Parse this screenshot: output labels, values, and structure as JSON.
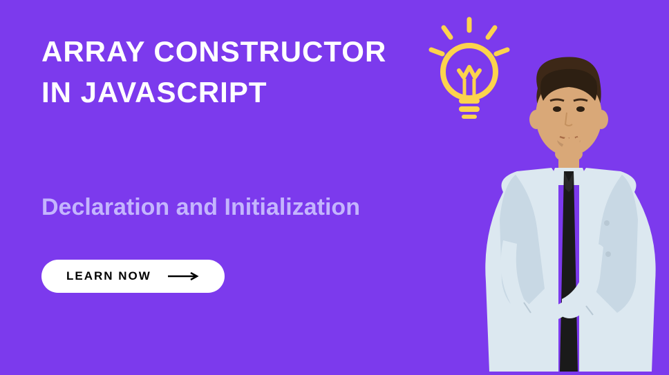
{
  "heading": {
    "line1": "ARRAY CONSTRUCTOR",
    "line2": "IN JAVASCRIPT"
  },
  "subtitle": "Declaration and Initialization",
  "cta": {
    "label": "LEARN NOW"
  },
  "colors": {
    "background": "#7c3aed",
    "title": "#ffffff",
    "subtitle": "#c4b5fd",
    "button_bg": "#ffffff",
    "button_text": "#000000",
    "lightbulb": "#fcd34d"
  },
  "icons": {
    "lightbulb": "lightbulb-icon",
    "arrow": "arrow-right-icon"
  }
}
